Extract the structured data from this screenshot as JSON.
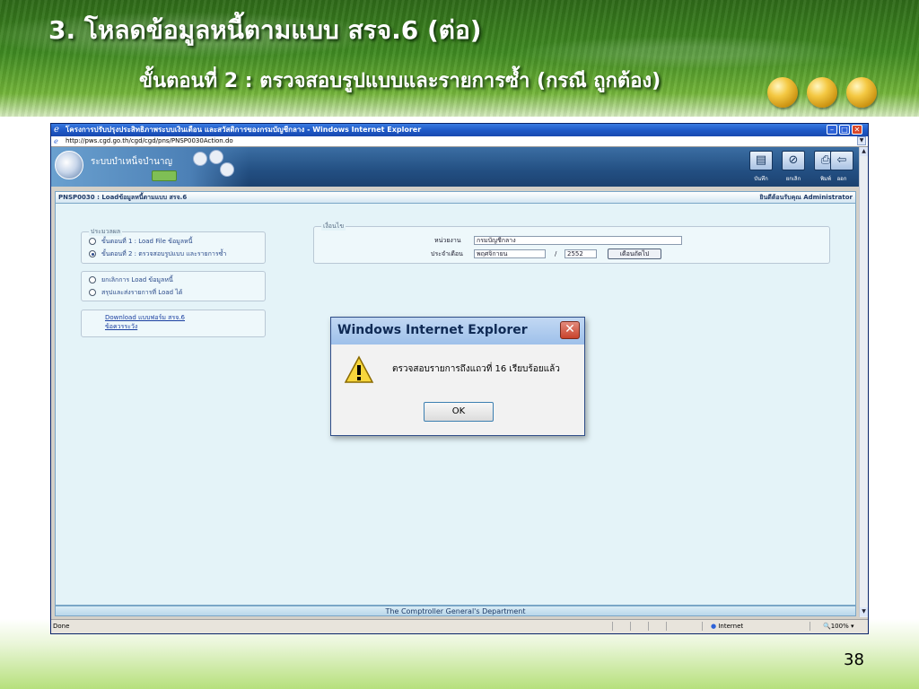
{
  "slide": {
    "title": "3. โหลดข้อมูลหนี้ตามแบบ สรจ.6 (ต่อ)",
    "subtitle": "ขั้นตอนที่ 2 : ตรวจสอบรูปแบบและรายการซ้ำ (กรณี ถูกต้อง)",
    "page_number": "38",
    "accent_color": "#3f8a22"
  },
  "browser": {
    "window_title": "โครงการปรับปรุงประสิทธิภาพระบบเงินเดือน และสวัสดิการของกรมบัญชีกลาง - Windows Internet Explorer",
    "address": "http://pws.cgd.go.th/cgd/cgd/pns/PNSP0030Action.do",
    "status_left": "Done",
    "status_zone": "Internet",
    "status_zoom": "100%"
  },
  "app": {
    "system_name": "ระบบบำเหน็จบำนาญ",
    "toolbar": [
      {
        "label": "บันทึก",
        "icon": "save-icon",
        "glyph": "▤"
      },
      {
        "label": "ยกเลิก",
        "icon": "cancel-icon",
        "glyph": "⊘"
      },
      {
        "label": "พิมพ์",
        "icon": "print-icon",
        "glyph": "⎙"
      },
      {
        "label": "ออก",
        "icon": "exit-icon",
        "glyph": "⇦"
      }
    ],
    "page_code": "PNSP0030 : Loadข้อมูลหนี้ตามแบบ สรจ.6",
    "welcome": "ยินดีต้อนรับคุณ Administrator",
    "footer": "The Comptroller General's Department"
  },
  "process_group": {
    "legend": "ประมวลผล",
    "steps": [
      {
        "label": "ขั้นตอนที่ 1 : Load File ข้อมูลหนี้",
        "selected": false
      },
      {
        "label": "ขั้นตอนที่ 2 : ตรวจสอบรูปแบบ และรายการซ้ำ",
        "selected": true
      }
    ]
  },
  "action_group": {
    "options": [
      {
        "label": "ยกเลิกการ Load ข้อมูลหนี้",
        "selected": false
      },
      {
        "label": "สรุปและส่งรายการที่ Load ได้",
        "selected": false
      }
    ]
  },
  "links_group": {
    "links": [
      "Download แบบฟอร์ม สรจ.6",
      "ข้อควรระวัง"
    ]
  },
  "condition_group": {
    "legend": "เงื่อนไข",
    "agency_label": "หน่วยงาน",
    "agency_value": "กรมบัญชีกลาง",
    "month_label": "ประจำเดือน",
    "month_value": "พฤศจิกายน",
    "separator": "/",
    "year_value": "2552",
    "next_month_button": "เดือนถัดไป"
  },
  "dialog": {
    "title": "Windows Internet Explorer",
    "message": "ตรวจสอบรายการถึงแถวที่ 16 เรียบร้อยแล้ว",
    "ok_label": "OK"
  }
}
